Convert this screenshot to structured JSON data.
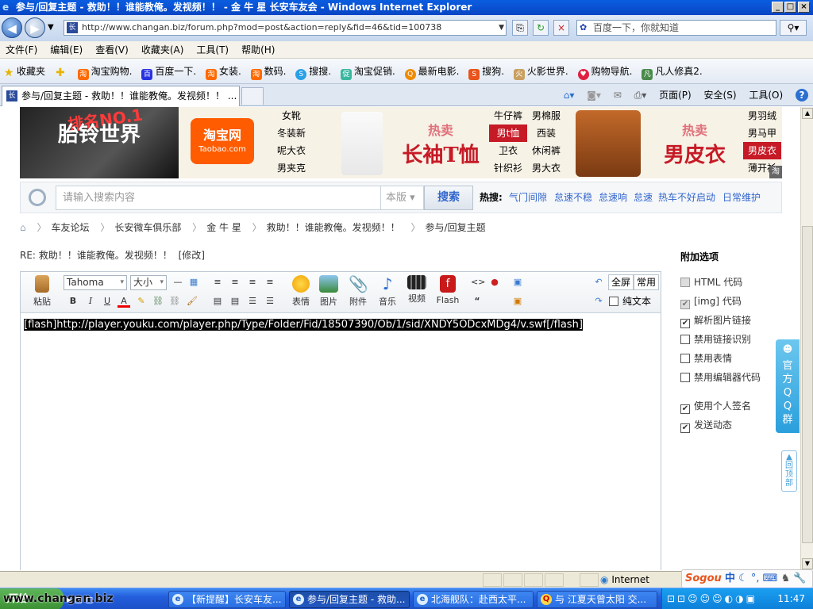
{
  "window": {
    "title": "参与/回复主题 - 救助！！谁能教俺。发视频！！ - 金 牛 星 长安车友会 - Windows Internet Explorer"
  },
  "address": {
    "url": "http://www.changan.biz/forum.php?mod=post&action=reply&fid=46&tid=100738",
    "search_placeholder": "百度一下，你就知道"
  },
  "menu": [
    "文件(F)",
    "编辑(E)",
    "查看(V)",
    "收藏夹(A)",
    "工具(T)",
    "帮助(H)"
  ],
  "favorites": {
    "label": "收藏夹",
    "items": [
      "淘宝购物.",
      "百度一下.",
      "女装.",
      "数码.",
      "搜搜.",
      "淘宝促销.",
      "最新电影.",
      "搜狗.",
      "火影世界.",
      "购物导航.",
      "凡人修真2."
    ]
  },
  "tabs": {
    "active": "参与/回复主题 - 救助！！谁能教俺。发视频！！ ..."
  },
  "commandbar": {
    "page": "页面(P)",
    "safety": "安全(S)",
    "tools": "工具(O)",
    "help": "?"
  },
  "banner": {
    "left_text_top": "排名NO.1",
    "left_text_main": "胎铃世界",
    "taobao_name": "淘宝网",
    "taobao_domain": "Taobao.com",
    "col1": [
      "女靴",
      "冬装新",
      "呢大衣",
      "男夹克"
    ],
    "col2": [
      "牛仔裤",
      "男t恤",
      "卫衣",
      "针织衫"
    ],
    "col3": [
      "男棉服",
      "西装",
      "休闲裤",
      "男大衣"
    ],
    "col4": [
      "男羽绒",
      "男马甲",
      "男皮衣",
      "薄开衫"
    ],
    "hot1_small": "热卖",
    "hot1_large": "长袖T恤",
    "hot2_small": "热卖",
    "hot2_large": "男皮衣",
    "tag": "淘"
  },
  "search": {
    "placeholder": "请输入搜索内容",
    "scope": "本版",
    "button": "搜索",
    "hot_label": "热搜:",
    "hot_keywords": [
      "气门间隙",
      "怠速不稳",
      "怠速响",
      "怠速",
      "热车不好启动",
      "日常维护"
    ]
  },
  "breadcrumb": [
    "车友论坛",
    "长安微车俱乐部",
    "金 牛 星",
    "救助！！谁能教俺。发视频！！",
    "参与/回复主题"
  ],
  "post": {
    "title": "RE: 救助！！谁能教俺。发视频！！",
    "edit_link": "[修改]"
  },
  "editor": {
    "paste": "粘贴",
    "font": "Tahoma",
    "size": "大小",
    "tools": [
      "表情",
      "图片",
      "附件",
      "音乐",
      "视频",
      "Flash"
    ],
    "fullscreen": "全屏",
    "common": "常用",
    "plaintext": "纯文本",
    "content": "[flash]http://player.youku.com/player.php/Type/Folder/Fid/18507390/Ob/1/sid/XNDY5ODcxMDg4/v.swf[/flash]"
  },
  "extra_options": {
    "heading": "附加选项",
    "options": [
      {
        "label": "HTML 代码",
        "checked": false,
        "disabled": true
      },
      {
        "label": "[img] 代码",
        "checked": true,
        "disabled": true
      },
      {
        "label": "解析图片链接",
        "checked": true,
        "disabled": false
      },
      {
        "label": "禁用链接识别",
        "checked": false,
        "disabled": false
      },
      {
        "label": "禁用表情",
        "checked": false,
        "disabled": false
      },
      {
        "label": "禁用编辑器代码",
        "checked": false,
        "disabled": false
      },
      {
        "label": "使用个人签名",
        "checked": true,
        "disabled": false
      },
      {
        "label": "发送动态",
        "checked": true,
        "disabled": false
      }
    ]
  },
  "sidebar": {
    "qq_group": "官方QQ群",
    "back_to_top": "回顶部"
  },
  "status": {
    "zone": "Internet"
  },
  "ime": {
    "brand": "Sogou",
    "mode": "中"
  },
  "taskbar": {
    "start": "开始",
    "watermark": "www.changan.biz",
    "tasks": [
      "【新提醒】长安车友...",
      "参与/回复主题 - 救助...",
      "北海舰队：赴西太平...",
      "与 江夏天曾太阳 交..."
    ],
    "clock": "11:47"
  },
  "colors": {
    "accent": "#3366cc",
    "taobao": "#ff5b00",
    "hot_red": "#c61a26",
    "titlebar": "#0a5de0"
  }
}
